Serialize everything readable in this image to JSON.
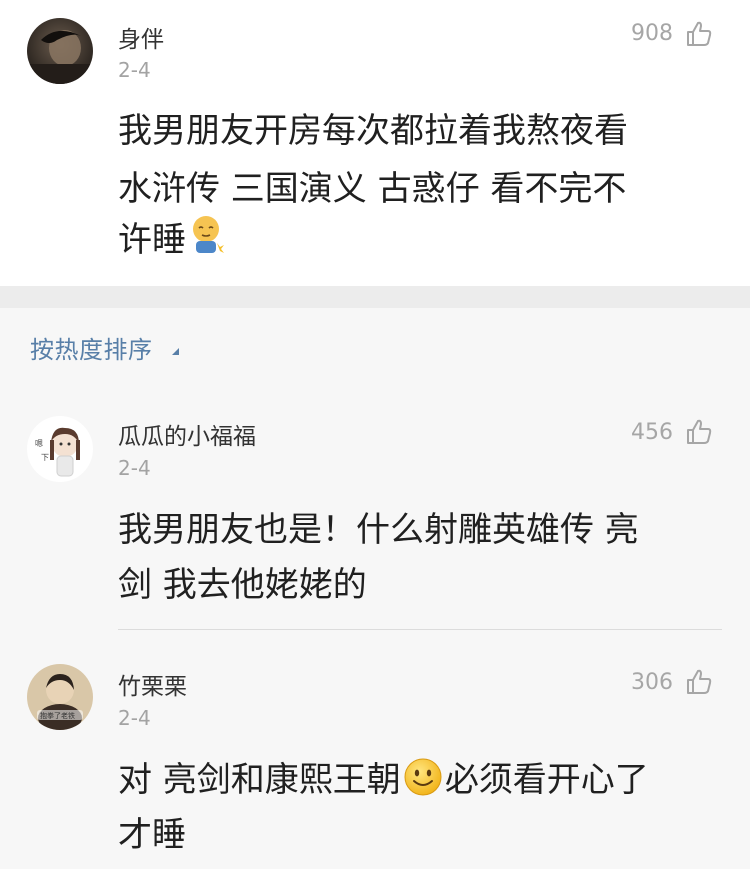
{
  "main_comment": {
    "username": "身伴",
    "date": "2-4",
    "like_count": "908",
    "text_lines": [
      "我男朋友开房每次都拉着我熬夜看",
      "水浒传  三国演义  古惑仔  看不完不",
      "许睡"
    ],
    "trailing_emoji": "sleepy-emoji"
  },
  "sort": {
    "label": "按热度排序"
  },
  "replies": [
    {
      "username": "瓜瓜的小福福",
      "date": "2-4",
      "like_count": "456",
      "text_lines": [
        "我男朋友也是！什么射雕英雄传 亮",
        "剑 我去他姥姥的"
      ]
    },
    {
      "username": "竹栗栗",
      "date": "2-4",
      "like_count": "306",
      "text_line_1_before": "对 亮剑和康熙王朝",
      "text_line_1_after": "必须看开心了",
      "text_line_2": "才睡",
      "inline_emoji": "smile-emoji"
    }
  ],
  "colors": {
    "link_blue": "#587fa8",
    "muted_gray": "#a3a3a3",
    "text_dark": "#202020",
    "section_gray": "#ececec",
    "reply_bg": "#f7f7f7"
  }
}
